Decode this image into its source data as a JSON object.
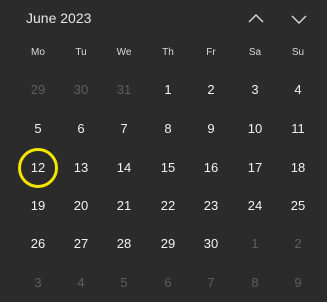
{
  "header": {
    "month_label": "June 2023",
    "prev_icon": "chevron-up-icon",
    "next_icon": "chevron-down-icon"
  },
  "weekdays": [
    "Mo",
    "Tu",
    "We",
    "Th",
    "Fr",
    "Sa",
    "Su"
  ],
  "weeks": [
    [
      {
        "d": "29",
        "out": true
      },
      {
        "d": "30",
        "out": true
      },
      {
        "d": "31",
        "out": true
      },
      {
        "d": "1"
      },
      {
        "d": "2"
      },
      {
        "d": "3"
      },
      {
        "d": "4"
      }
    ],
    [
      {
        "d": "5"
      },
      {
        "d": "6"
      },
      {
        "d": "7"
      },
      {
        "d": "8"
      },
      {
        "d": "9"
      },
      {
        "d": "10"
      },
      {
        "d": "11"
      }
    ],
    [
      {
        "d": "12",
        "today": true
      },
      {
        "d": "13"
      },
      {
        "d": "14"
      },
      {
        "d": "15"
      },
      {
        "d": "16"
      },
      {
        "d": "17"
      },
      {
        "d": "18"
      }
    ],
    [
      {
        "d": "19"
      },
      {
        "d": "20"
      },
      {
        "d": "21"
      },
      {
        "d": "22"
      },
      {
        "d": "23"
      },
      {
        "d": "24"
      },
      {
        "d": "25"
      }
    ],
    [
      {
        "d": "26"
      },
      {
        "d": "27"
      },
      {
        "d": "28"
      },
      {
        "d": "29"
      },
      {
        "d": "30"
      },
      {
        "d": "1",
        "out": true
      },
      {
        "d": "2",
        "out": true
      }
    ],
    [
      {
        "d": "3",
        "out": true
      },
      {
        "d": "4",
        "out": true
      },
      {
        "d": "5",
        "out": true
      },
      {
        "d": "6",
        "out": true
      },
      {
        "d": "7",
        "out": true
      },
      {
        "d": "8",
        "out": true
      },
      {
        "d": "9",
        "out": true
      }
    ]
  ],
  "colors": {
    "background": "#2b2b2b",
    "text": "#f2f2f2",
    "muted_text": "#5e5e5e",
    "today_ring": "#f5e600"
  }
}
